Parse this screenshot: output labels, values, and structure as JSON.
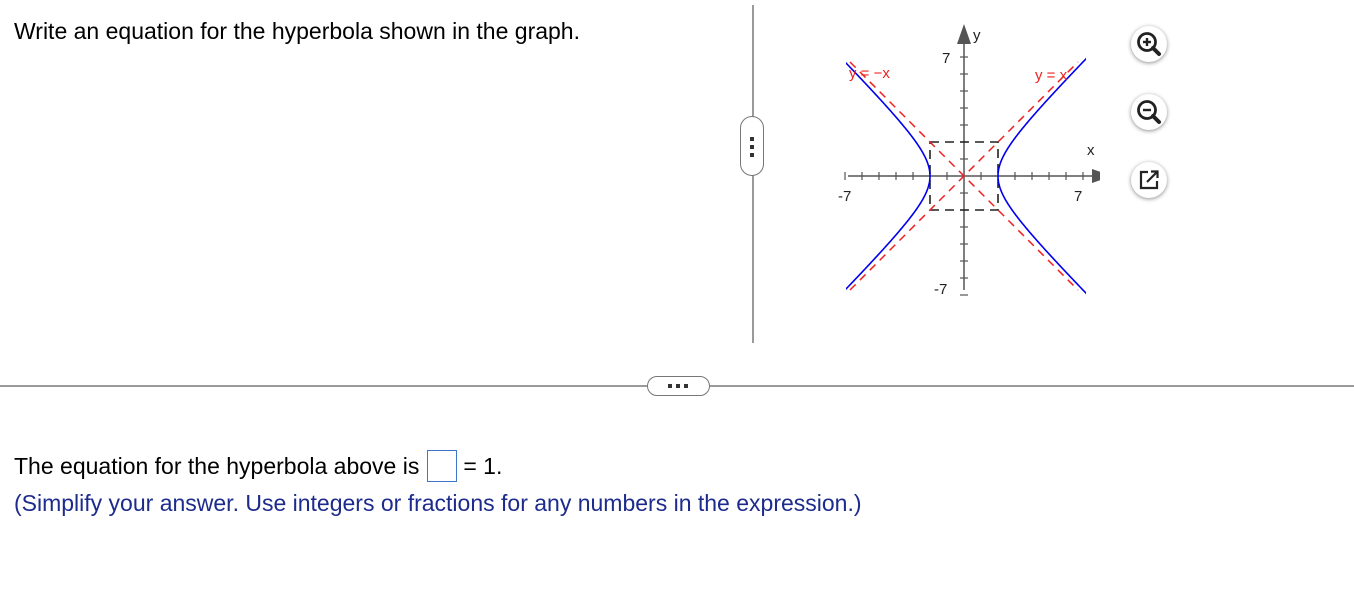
{
  "question": {
    "text": "Write an equation for the hyperbola shown in the graph."
  },
  "graph": {
    "y_axis_label": "y",
    "x_axis_label": "x",
    "tick_labels": {
      "x_min": "-7",
      "x_max": "7",
      "y_max": "7",
      "y_min": "-7"
    },
    "asymptote_labels": {
      "negative": "y = −x",
      "positive": "y = x"
    },
    "axis_range": [
      -7,
      7
    ],
    "box_half_width": 2,
    "box_half_height": 2,
    "vertices": [
      [
        -2,
        0
      ],
      [
        2,
        0
      ]
    ],
    "colors": {
      "hyperbola": "#0000ee",
      "asymptote": "#ee2222",
      "axes": "#555555"
    }
  },
  "tools": {
    "zoom_in_icon": "zoom-in-icon",
    "zoom_out_icon": "zoom-out-icon",
    "popout_icon": "popout-icon"
  },
  "answer": {
    "prefix": "The equation for the hyperbola above is",
    "suffix": "= 1.",
    "input_value": ""
  },
  "hint": {
    "text": "(Simplify your answer. Use integers or fractions for any numbers in the expression.)"
  }
}
